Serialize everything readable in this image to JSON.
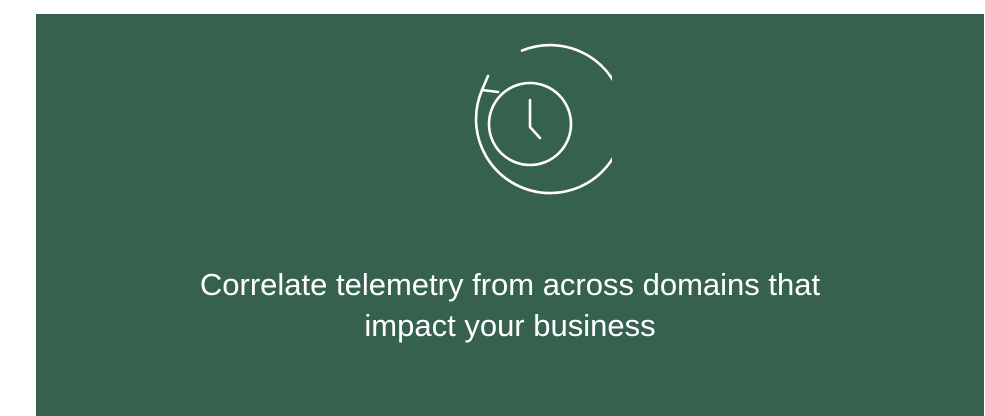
{
  "card": {
    "background": "#35614e",
    "icon": "clock-history-icon",
    "headline_line1": "Correlate telemetry from across domains that",
    "headline_line2": "impact your business"
  }
}
